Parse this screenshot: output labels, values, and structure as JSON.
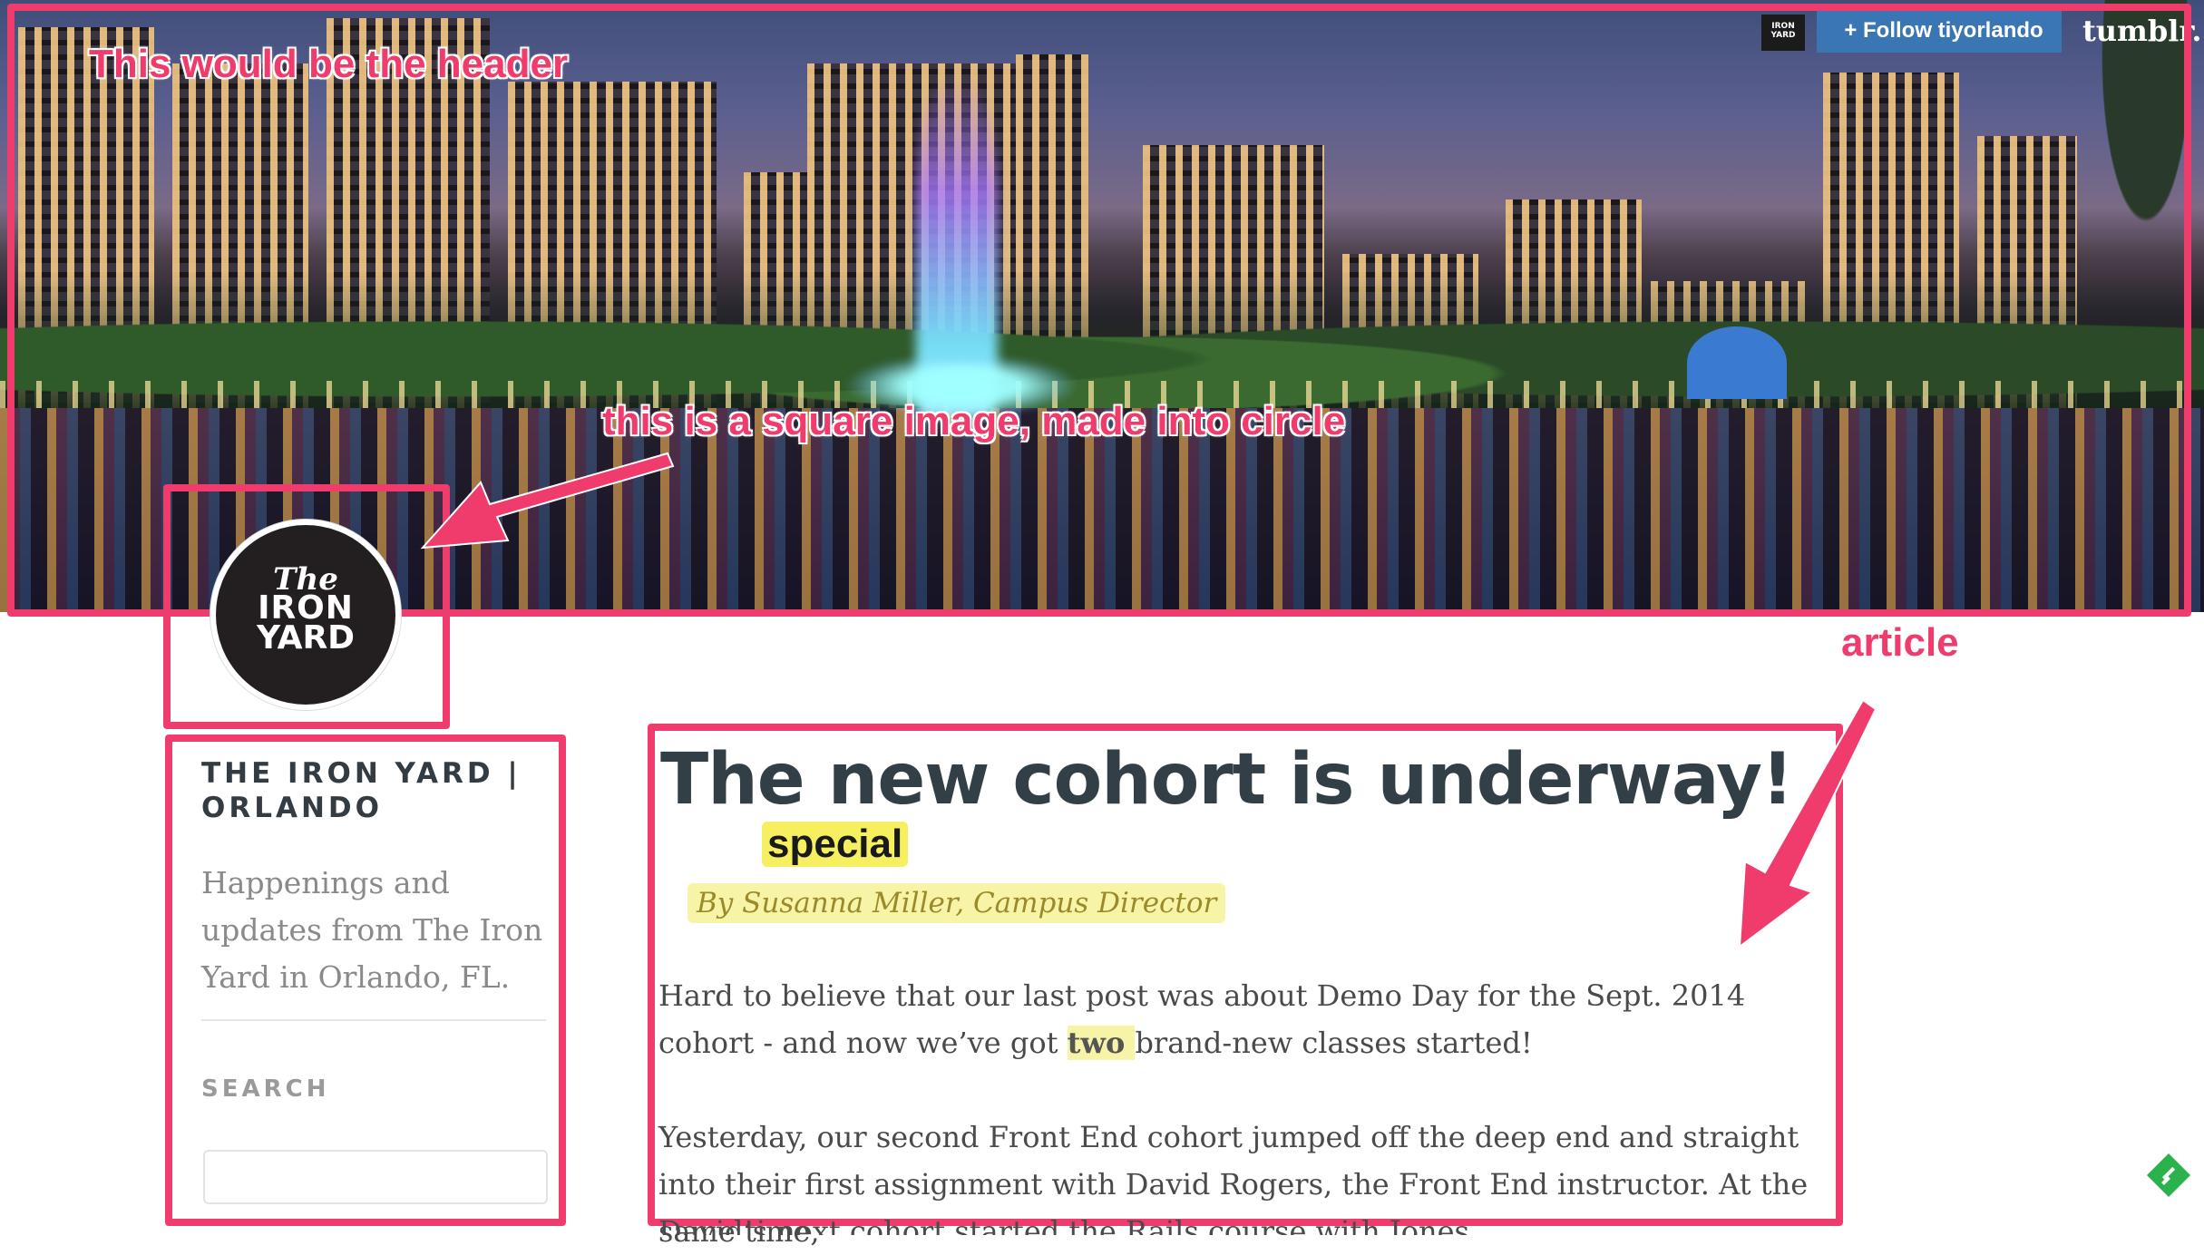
{
  "tumblr_bar": {
    "logo_text": "IRON YARD",
    "follow_label": "+ Follow tiyorlando",
    "brand": "tumblr."
  },
  "annotations": {
    "header": "This would be the header",
    "circle": "this is a square image, made into circle",
    "article": "article",
    "special": "special",
    "color": "#ef3c6d"
  },
  "logo": {
    "the": "The",
    "iron": "IRON",
    "yard": "YARD"
  },
  "sidebar": {
    "title": "THE IRON YARD | ORLANDO",
    "description": "Happenings and updates from The Iron Yard in Orlando, FL.",
    "search_label": "SEARCH",
    "search_value": ""
  },
  "article": {
    "title": "The new cohort is underway!",
    "byline": "By Susanna Miller, Campus Director",
    "p1_before": "Hard to believe that our last post was about Demo Day for the Sept. 2014 cohort - and now we’ve got ",
    "p1_highlight": "two ",
    "p1_after": "brand-new classes started!",
    "p2": "Yesterday, our second Front End cohort jumped off the deep end and straight into their first assignment with David Rogers, the Front End instructor. At the same time,",
    "p3": "David’s next cohort started the Rails course with Jones"
  },
  "colors": {
    "annotation": "#ef3c6d",
    "highlight": "#f7f4a8",
    "follow_button": "#3a76b4",
    "title_text": "#333f47"
  }
}
